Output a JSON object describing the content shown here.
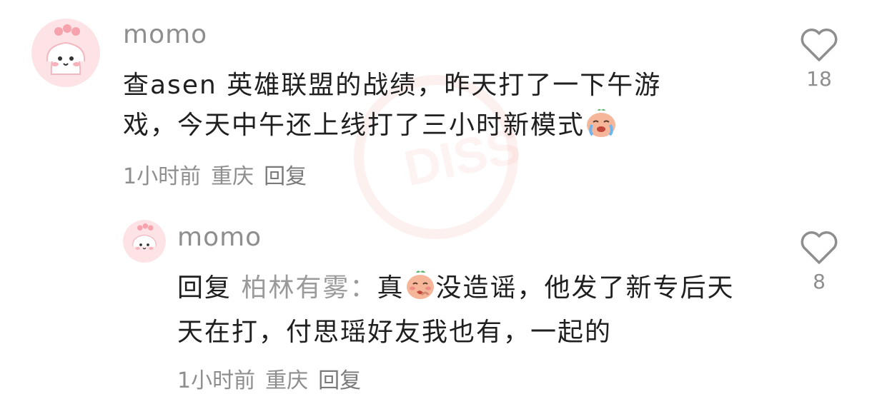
{
  "comments": [
    {
      "username": "momo",
      "text_before_emoji": "查asen 英雄联盟的战绩，昨天打了一下午游戏，今天中午还上线打了三小时新模式",
      "time": "1小时前",
      "location": "重庆",
      "reply_label": "回复",
      "likes": "18"
    }
  ],
  "reply": {
    "username": "momo",
    "prefix": "回复",
    "mention": "柏林有雾：",
    "text_part1": "真",
    "text_part2": "没造谣，他发了新专后天天在打，付思瑶好友我也有，一起的",
    "time": "1小时前",
    "location": "重庆",
    "reply_label": "回复",
    "likes": "8"
  },
  "colors": {
    "text_primary": "#1f1f1f",
    "text_secondary": "#8e8e8e",
    "avatar_bg": "#fde3e6"
  }
}
